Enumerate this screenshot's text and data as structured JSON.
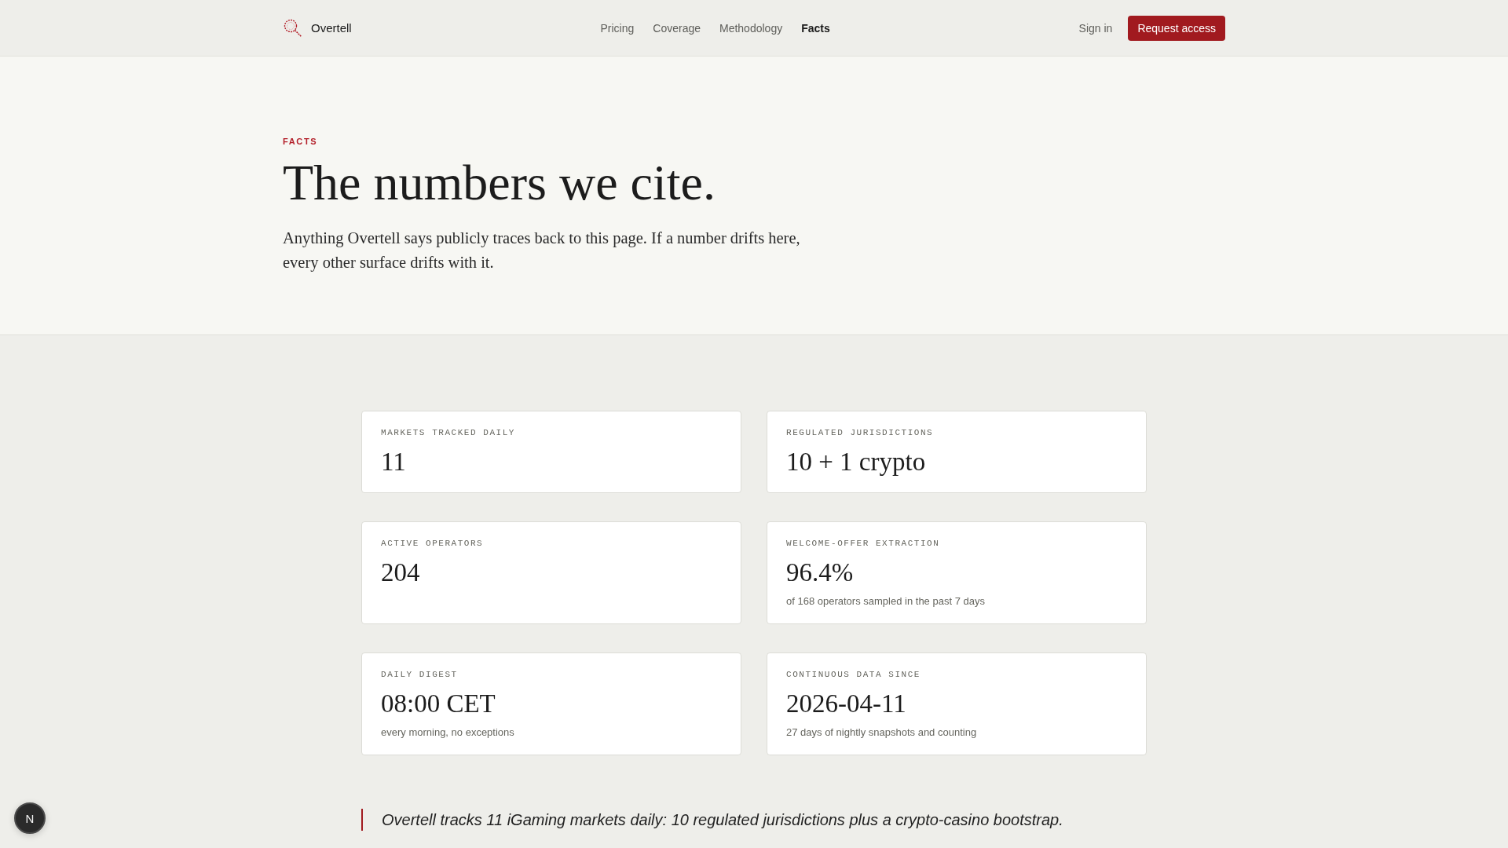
{
  "header": {
    "brand": "Overtell",
    "nav": [
      {
        "label": "Pricing",
        "selected": false
      },
      {
        "label": "Coverage",
        "selected": false
      },
      {
        "label": "Methodology",
        "selected": false
      },
      {
        "label": "Facts",
        "selected": true
      }
    ],
    "sign_in": "Sign in",
    "cta": "Request access"
  },
  "hero": {
    "eyebrow": "FACTS",
    "title": "The numbers we cite.",
    "lede": "Anything Overtell says publicly traces back to this page. If a number drifts here, every other surface drifts with it."
  },
  "facts": [
    {
      "label": "MARKETS TRACKED DAILY",
      "value": "11"
    },
    {
      "label": "REGULATED JURISDICTIONS",
      "value": "10 + 1 crypto"
    },
    {
      "label": "ACTIVE OPERATORS",
      "value": "204"
    },
    {
      "label": "WELCOME-OFFER EXTRACTION",
      "value": "96.4%",
      "note": "of 168 operators sampled in the past 7 days"
    },
    {
      "label": "DAILY DIGEST",
      "value": "08:00 CET",
      "note": "every morning, no exceptions"
    },
    {
      "label": "CONTINUOUS DATA SINCE",
      "value": "2026-04-11",
      "note": "27 days of nightly snapshots and counting"
    }
  ],
  "quote": "Overtell tracks 11 iGaming markets daily: 10 regulated jurisdictions plus a crypto-casino bootstrap.",
  "dev_badge": "N"
}
